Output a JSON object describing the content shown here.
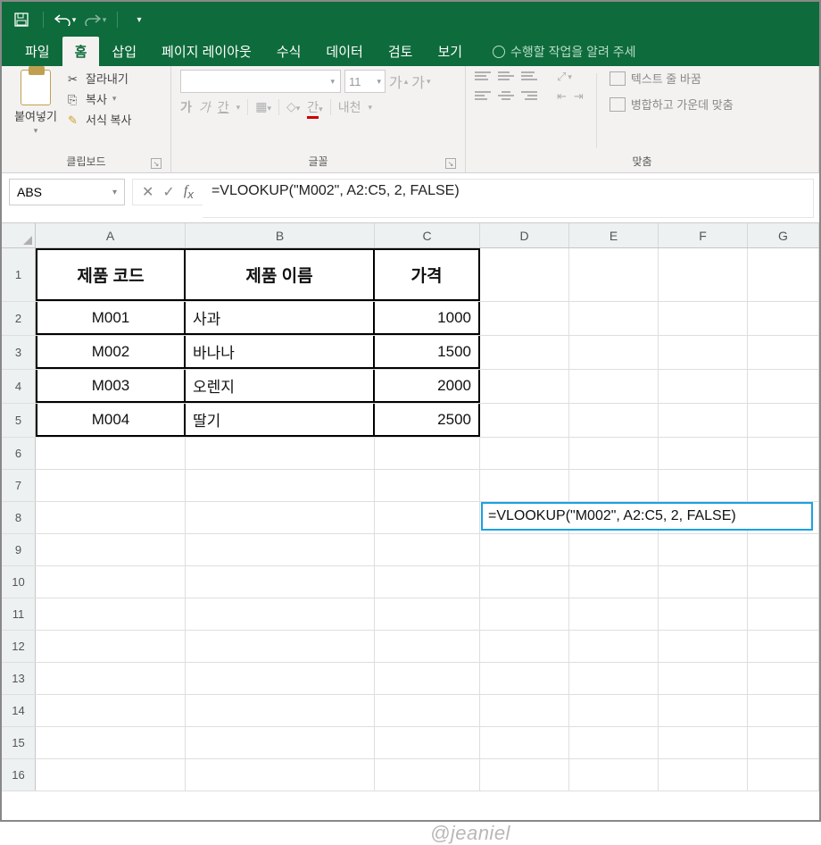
{
  "titlebar": {
    "save_icon": "save",
    "undo_icon": "undo",
    "redo_icon": "redo"
  },
  "tabs": {
    "file": "파일",
    "home": "홈",
    "insert": "삽입",
    "page_layout": "페이지 레이아웃",
    "formulas": "수식",
    "data": "데이터",
    "review": "검토",
    "view": "보기",
    "tell_me": "수행할 작업을 알려 주세"
  },
  "ribbon": {
    "clipboard": {
      "paste": "붙여넣기",
      "cut": "잘라내기",
      "copy": "복사",
      "format_painter": "서식 복사",
      "label": "클립보드"
    },
    "font": {
      "label": "글꼴",
      "size": "11",
      "inc": "가",
      "dec": "가",
      "bold": "가",
      "italic": "가",
      "underline": "간",
      "wrap_abbr": "내천"
    },
    "align": {
      "label": "맞춤",
      "wrap_text": "텍스트 줄 바꿈",
      "merge_center": "병합하고 가운데 맞춤"
    }
  },
  "namebox": "ABS",
  "formula": "=VLOOKUP(\"M002\", A2:C5, 2, FALSE)",
  "columns": [
    "A",
    "B",
    "C",
    "D",
    "E",
    "F",
    "G"
  ],
  "row_numbers": [
    1,
    2,
    3,
    4,
    5,
    6,
    7,
    8,
    9,
    10,
    11,
    12,
    13,
    14,
    15,
    16
  ],
  "table": {
    "headers": {
      "A": "제품 코드",
      "B": "제품 이름",
      "C": "가격"
    },
    "rows": [
      {
        "A": "M001",
        "B": "사과",
        "C": "1000"
      },
      {
        "A": "M002",
        "B": "바나나",
        "C": "1500"
      },
      {
        "A": "M003",
        "B": "오렌지",
        "C": "2000"
      },
      {
        "A": "M004",
        "B": "딸기",
        "C": "2500"
      }
    ]
  },
  "active_cell_text": "=VLOOKUP(\"M002\", A2:C5, 2, FALSE)",
  "watermark": "@jeaniel"
}
